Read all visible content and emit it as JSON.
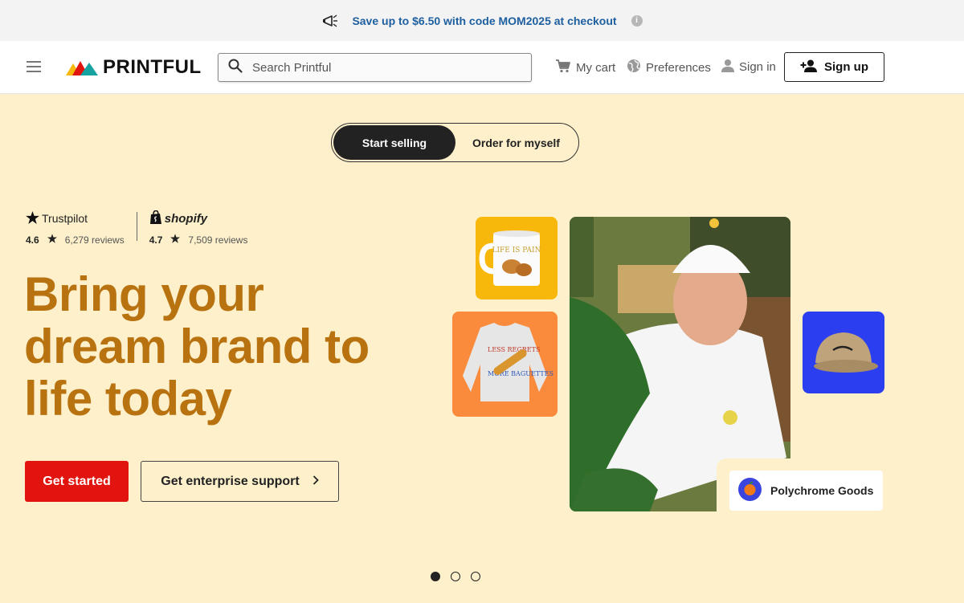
{
  "promo": {
    "text": "Save up to $6.50 with code MOM2025 at checkout",
    "info_icon": "info-icon"
  },
  "header": {
    "logo_text": "PRINTFUL",
    "search_placeholder": "Search Printful",
    "cart_label": "My cart",
    "preferences_label": "Preferences",
    "signin_label": "Sign in",
    "signup_label": "Sign up"
  },
  "toggle": {
    "options": [
      "Start selling",
      "Order for myself"
    ],
    "active": "Start selling"
  },
  "ratings": {
    "trustpilot": {
      "brand": "Trustpilot",
      "score": "4.6",
      "reviews": "6,279 reviews"
    },
    "shopify": {
      "brand": "shopify",
      "score": "4.7",
      "reviews": "7,509 reviews"
    }
  },
  "hero": {
    "headline": "Bring your dream brand to life today",
    "cta_primary": "Get started",
    "cta_secondary": "Get enterprise support"
  },
  "products": {
    "mug_text": "LIFE IS PAIN",
    "sweater_text_1": "LESS REGRETS",
    "sweater_text_2": "MORE BAGUETTES"
  },
  "brand_badge": {
    "name": "Polychrome Goods"
  },
  "carousel": {
    "count": 3,
    "active_index": 0
  },
  "colors": {
    "accent_red": "#e1140f",
    "headline": "#b8720f",
    "hero_bg": "#fdf0cb",
    "promo_text": "#1e5fa0"
  }
}
